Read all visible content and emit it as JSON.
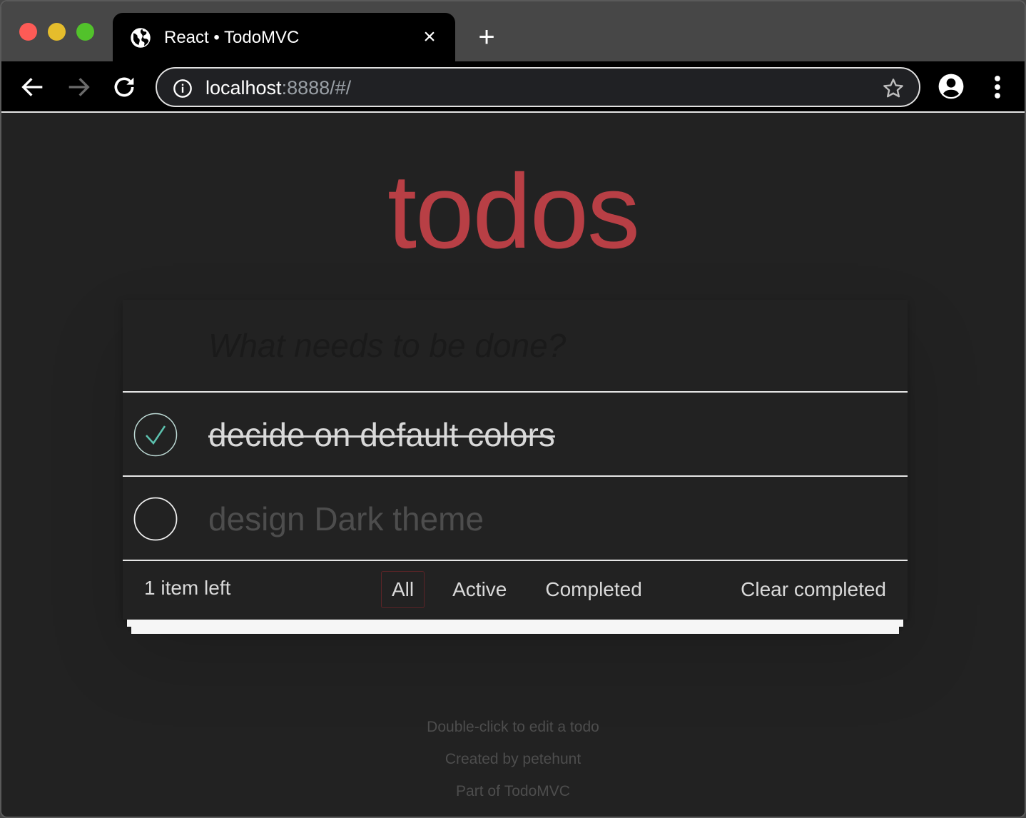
{
  "browser": {
    "tab": {
      "title": "React • TodoMVC",
      "favicon": "globe-icon",
      "close_icon": "×"
    },
    "new_tab_icon": "+",
    "url": {
      "host": "localhost",
      "rest": ":8888/#/"
    },
    "icons": {
      "back": "arrow-left-icon",
      "forward": "arrow-right-icon",
      "reload": "reload-icon",
      "info": "info-icon",
      "bookmark": "star-icon",
      "profile": "account-circle-icon",
      "menu": "more-vert-icon"
    }
  },
  "app": {
    "title": "todos",
    "new_todo": {
      "placeholder": "What needs to be done?",
      "value": ""
    },
    "todos": [
      {
        "label": "decide on default colors",
        "completed": true
      },
      {
        "label": "design Dark theme",
        "completed": false
      }
    ],
    "footer": {
      "count_number": "1",
      "count_text": " item left",
      "filters": [
        {
          "label": "All",
          "selected": true
        },
        {
          "label": "Active",
          "selected": false
        },
        {
          "label": "Completed",
          "selected": false
        }
      ],
      "clear_completed": "Clear completed"
    },
    "colors": {
      "accent": "#b83f45",
      "check": "#5dc2af",
      "background": "#222222"
    }
  },
  "info": {
    "hint": "Double-click to edit a todo",
    "created_prefix": "Created by ",
    "created_author": "petehunt",
    "part_prefix": "Part of ",
    "part_link": "TodoMVC"
  }
}
